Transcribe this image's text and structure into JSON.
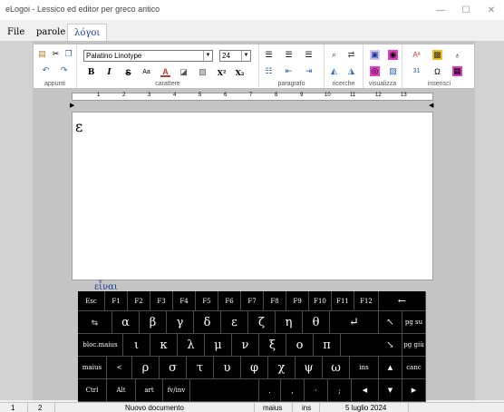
{
  "window": {
    "title": "eLogoi - Lessico ed editor per greco antico"
  },
  "menu": {
    "file": "File",
    "parole": "parole",
    "logoi": "λόγοι"
  },
  "ribbon": {
    "groups": {
      "appunti": "appunti",
      "carattere": "carattere",
      "paragrafo": "paragrafo",
      "ricerche": "ricerche",
      "visualizza": "visualizza",
      "inserisci": "inserisci"
    },
    "font": "Palatino Linotype",
    "size": "24",
    "bold": "B",
    "italic": "I",
    "strike": "S",
    "case": "Aa",
    "fontcolor": "A",
    "sup": "X²",
    "sub": "X₂"
  },
  "ruler": {
    "ticks": [
      "1",
      "2",
      "3",
      "4",
      "5",
      "6",
      "7",
      "8",
      "9",
      "10",
      "11",
      "12",
      "13"
    ]
  },
  "editor": {
    "text": "ε"
  },
  "suggestion": "εἶναι",
  "keyboard": {
    "row1": [
      "Esc",
      "F1",
      "F2",
      "F3",
      "F4",
      "F5",
      "F6",
      "F7",
      "F8",
      "F9",
      "F10",
      "F11",
      "F12",
      "←"
    ],
    "row2": [
      "↹",
      "α",
      "β",
      "γ",
      "δ",
      "ε",
      "ζ",
      "η",
      "θ",
      "↵",
      "↖",
      "pg su"
    ],
    "row3": [
      "bloc.maius",
      "ι",
      "κ",
      "λ",
      "μ",
      "ν",
      "ξ",
      "ο",
      "π",
      "↘",
      "pg giù"
    ],
    "row4": [
      "maius",
      "<",
      "ρ",
      "σ",
      "τ",
      "υ",
      "φ",
      "χ",
      "ψ",
      "ω",
      "ins",
      "▲",
      "canc"
    ],
    "row5": [
      "Ctrl",
      "Alt",
      "art",
      "fv/inv",
      ".",
      ",",
      "·",
      ";",
      "◀",
      "▼",
      "▶"
    ]
  },
  "status": {
    "line": "1",
    "col": "2",
    "doc": "Nuovo documento",
    "caps": "maius",
    "ins": "ins",
    "date": "5 luglio 2024"
  },
  "colors": {
    "accent": "#1a3a9c",
    "kb": "#000000"
  }
}
